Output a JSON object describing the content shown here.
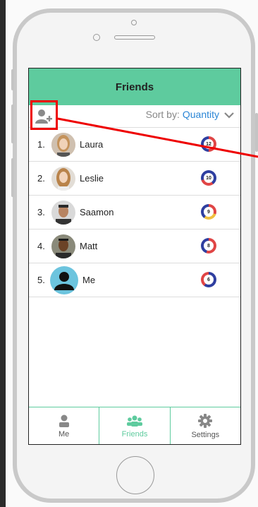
{
  "header": {
    "title": "Friends"
  },
  "sort": {
    "label": "Sort by:",
    "value": "Quantity"
  },
  "friends": [
    {
      "rank": "1.",
      "name": "Laura",
      "count": "12"
    },
    {
      "rank": "2.",
      "name": "Leslie",
      "count": "10"
    },
    {
      "rank": "3.",
      "name": "Saamon",
      "count": "9"
    },
    {
      "rank": "4.",
      "name": "Matt",
      "count": "8"
    },
    {
      "rank": "5.",
      "name": "Me",
      "count": "6"
    }
  ],
  "tabs": [
    {
      "label": "Me",
      "icon": "person-icon"
    },
    {
      "label": "Friends",
      "icon": "people-icon"
    },
    {
      "label": "Settings",
      "icon": "gear-icon"
    }
  ],
  "colors": {
    "accent": "#5ecb9e",
    "link": "#2b86d6",
    "highlight": "#e00000"
  }
}
